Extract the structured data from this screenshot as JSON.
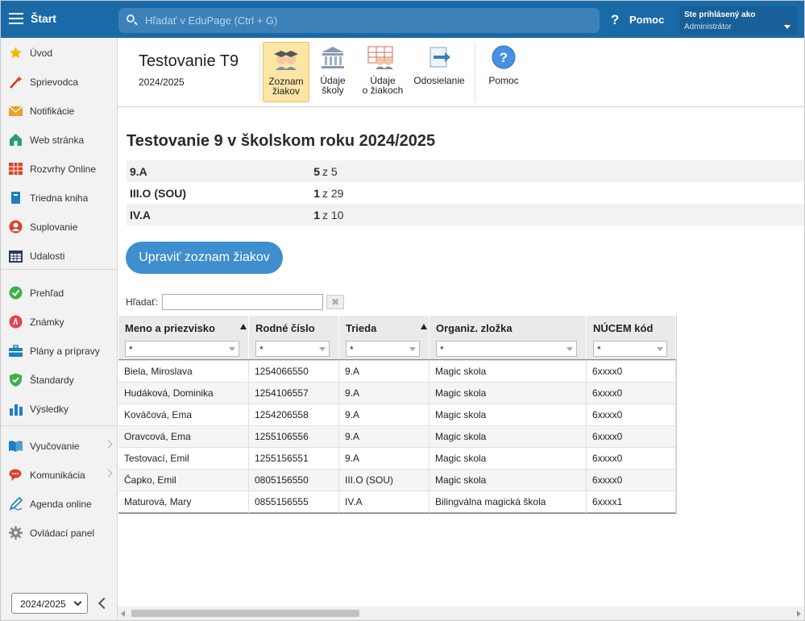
{
  "topbar": {
    "start_label": "Štart",
    "search_placeholder": "Hľadať v EduPage (Ctrl + G)",
    "help_label": "Pomoc",
    "user_line1": "Ste prihlásený ako",
    "user_line2": "Administrátor",
    "brand_color": "#1a6aa8"
  },
  "sidebar": {
    "items": [
      {
        "label": "Úvod",
        "icon": "star-icon",
        "color": "#f2b705"
      },
      {
        "label": "Sprievodca",
        "icon": "magic-wand-icon",
        "color": "#d9361e"
      },
      {
        "label": "Notifikácie",
        "icon": "envelope-icon",
        "color": "#f0a020"
      },
      {
        "label": "Web stránka",
        "icon": "home-icon",
        "color": "#2a9d6a"
      },
      {
        "label": "Rozvrhy Online",
        "icon": "timetable-icon",
        "color": "#d9432c"
      },
      {
        "label": "Triedna kniha",
        "icon": "book-icon",
        "color": "#1d7fc4"
      },
      {
        "label": "Suplovanie",
        "icon": "person-icon",
        "color": "#d9432c"
      },
      {
        "label": "Udalosti",
        "icon": "calendar-icon",
        "color": "#2b3b55"
      },
      {
        "label": "Prehľad",
        "icon": "check-circle-icon",
        "color": "#3cb04a"
      },
      {
        "label": "Známky",
        "icon": "grades-icon",
        "color": "#e0444c"
      },
      {
        "label": "Plány a prípravy",
        "icon": "briefcase-icon",
        "color": "#1d7fc4"
      },
      {
        "label": "Štandardy",
        "icon": "shield-check-icon",
        "color": "#3cb04a"
      },
      {
        "label": "Výsledky",
        "icon": "bar-chart-icon",
        "color": "#1d7fc4"
      },
      {
        "label": "Vyučovanie",
        "icon": "open-book-icon",
        "color": "#1d7fc4"
      },
      {
        "label": "Komunikácia",
        "icon": "chat-icon",
        "color": "#d9432c"
      },
      {
        "label": "Agenda online",
        "icon": "pen-icon",
        "color": "#1d7fc4"
      },
      {
        "label": "Ovládací panel",
        "icon": "gear-icon",
        "color": "#888888"
      }
    ],
    "year_value": "2024/2025"
  },
  "toolbar": {
    "title": "Testovanie T9",
    "subtitle": "2024/2025",
    "buttons": [
      {
        "l1": "Zoznam",
        "l2": "žiakov"
      },
      {
        "l1": "Údaje",
        "l2": "školy"
      },
      {
        "l1": "Údaje",
        "l2": "o žiakoch"
      },
      {
        "l1": "Odosielanie",
        "l2": ""
      },
      {
        "l1": "Pomoc",
        "l2": ""
      }
    ]
  },
  "main": {
    "title": "Testovanie 9 v školskom roku 2024/2025",
    "summary": [
      {
        "cls": "9.A",
        "n": "5",
        "rest": "z 5"
      },
      {
        "cls": "III.O (SOU)",
        "n": "1",
        "rest": "z 29"
      },
      {
        "cls": "IV.A",
        "n": "1",
        "rest": "z 10"
      }
    ],
    "edit_button": "Upraviť zoznam žiakov",
    "find_label": "Hľadať:",
    "find_clear": "✖"
  },
  "table": {
    "columns": [
      "Meno a priezvisko",
      "Rodné číslo",
      "Trieda",
      "Organiz. zložka",
      "NÚCEM kód"
    ],
    "filter_value": "*",
    "rows": [
      [
        "Biela, Miroslava",
        "1254066550",
        "9.A",
        "Magic skola",
        "6xxxx0"
      ],
      [
        "Hudáková, Dominika",
        "1254106557",
        "9.A",
        "Magic skola",
        "6xxxx0"
      ],
      [
        "Kováčová, Ema",
        "1254206558",
        "9.A",
        "Magic skola",
        "6xxxx0"
      ],
      [
        "Oravcová, Ema",
        "1255106556",
        "9.A",
        "Magic skola",
        "6xxxx0"
      ],
      [
        "Testovací, Emil",
        "1255156551",
        "9.A",
        "Magic skola",
        "6xxxx0"
      ],
      [
        "Čapko, Emil",
        "0805156550",
        "III.O (SOU)",
        "Magic skola",
        "6xxxx0"
      ],
      [
        "Maturová, Mary",
        "0855156555",
        "IV.A",
        "Bilingválna magická škola",
        "6xxxx1"
      ]
    ]
  }
}
